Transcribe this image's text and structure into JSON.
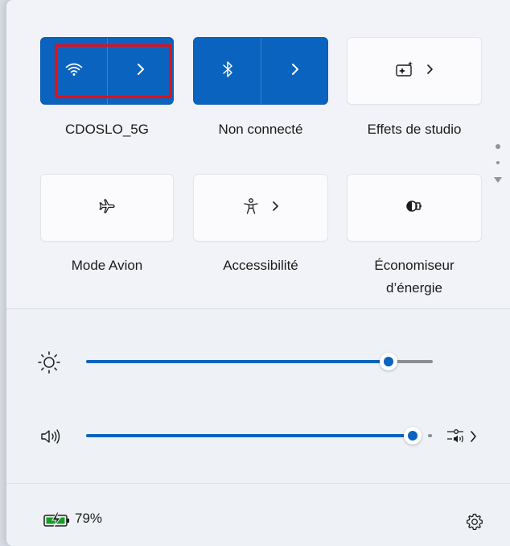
{
  "tiles": [
    {
      "id": "wifi",
      "label": "CDOSLO_5G",
      "active": true
    },
    {
      "id": "bluetooth",
      "label": "Non connecté",
      "active": true
    },
    {
      "id": "studio-effects",
      "label": "Effets de studio",
      "active": false
    },
    {
      "id": "airplane",
      "label": "Mode Avion",
      "active": false
    },
    {
      "id": "accessibility",
      "label": "Accessibilité",
      "active": false
    },
    {
      "id": "energy-saver",
      "label_line1": "Économiseur",
      "label_line2": "d’énergie",
      "active": false
    }
  ],
  "sliders": {
    "brightness": {
      "value_percent": 86
    },
    "volume": {
      "value_percent": 100
    }
  },
  "battery": {
    "percent_text": "79%",
    "charging": true
  },
  "colors": {
    "accent": "#0a63be",
    "highlight_box": "#e0101a",
    "track_inactive": "#8a8f96"
  },
  "icons": {
    "wifi": "wifi-icon",
    "bluetooth": "bluetooth-icon",
    "studio": "studio-effects-icon",
    "airplane": "airplane-icon",
    "accessibility": "accessibility-icon",
    "energy": "energy-saver-icon",
    "brightness": "sun-icon",
    "volume": "speaker-icon",
    "audio_output": "audio-output-icon",
    "battery": "battery-charging-icon",
    "settings": "gear-icon"
  }
}
